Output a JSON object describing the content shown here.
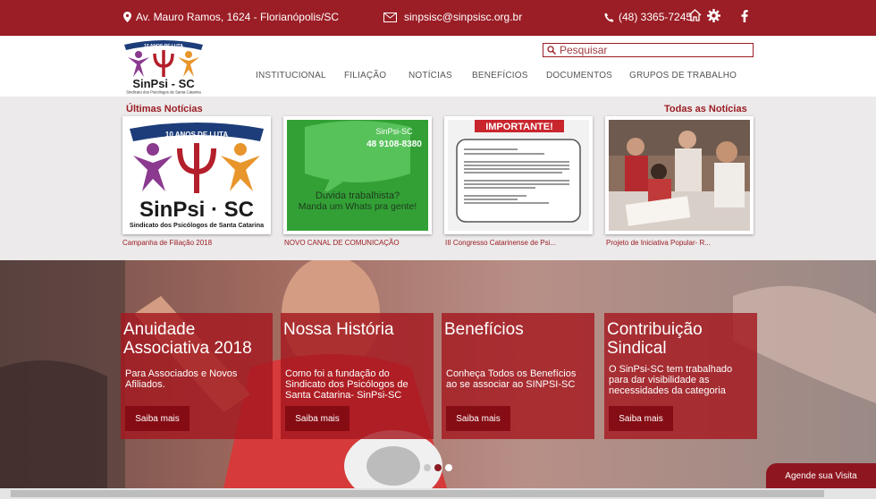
{
  "topbar": {
    "address": "Av. Mauro Ramos, 1624 -  Florianópolis/SC",
    "email": "sinpsisc@sinpsisc.org.br",
    "phone": "(48) 3365-7245",
    "icons": [
      "location-pin-icon",
      "envelope-icon",
      "phone-icon",
      "home-icon",
      "gear-icon",
      "facebook-icon"
    ]
  },
  "logo": {
    "banner_text": "10 ANOS DE LUTA",
    "name": "SinPsi - SC",
    "subtitle": "Sindicato dos Psicólogos de Santa Catarina"
  },
  "search": {
    "placeholder": "Pesquisar"
  },
  "nav": {
    "items": [
      "INSTITUCIONAL",
      "FILIAÇÃO",
      "NOTÍCIAS",
      "BENEFÍCIOS",
      "DOCUMENTOS",
      "GRUPOS DE TRABALHO"
    ]
  },
  "news": {
    "title": "Últimas Notícias",
    "all_link": "Todas as Notícias",
    "cards": [
      {
        "caption": "Campanha de Filiação 2018",
        "img_text": [
          "10 ANOS DE LUTA",
          "SinPsi · SC",
          "Sindicato dos Psicólogos de Santa Catarina"
        ]
      },
      {
        "caption": "NOVO CANAL DE COMUNICAÇÃO",
        "img_text": [
          "SinPsi-SC",
          "48 9108-8380",
          "Dúvida trabalhista?",
          "Manda um Whats pra gente!"
        ]
      },
      {
        "caption": "III Congresso Catarinense de Psi...",
        "img_text": [
          "IMPORTANTE!"
        ]
      },
      {
        "caption": "Projeto de Iniciativa Popular- R...",
        "img_text": []
      }
    ]
  },
  "panels": [
    {
      "title": "Anuidade\nAssociativa 2018",
      "desc": "Para Associados e Novos Afiliados.",
      "button": "Saiba mais"
    },
    {
      "title": "Nossa História",
      "desc": "Como foi a fundação do Sindicato dos Psicólogos de Santa Catarina- SinPsi-SC",
      "button": "Saiba mais"
    },
    {
      "title": "Benefícios",
      "desc": "Conheça Todos os Benefícios ao se associar ao SINPSI-SC",
      "button": "Saiba mais"
    },
    {
      "title": "Contribuição\nSindical",
      "desc": "O SinPsi-SC tem trabalhado para dar visibilidade as necessidades da categoria",
      "button": "Saiba mais"
    }
  ],
  "agende": {
    "label": "Agende sua Visita"
  },
  "colors": {
    "brand": "#9b1d25",
    "panel": "#a51820"
  }
}
